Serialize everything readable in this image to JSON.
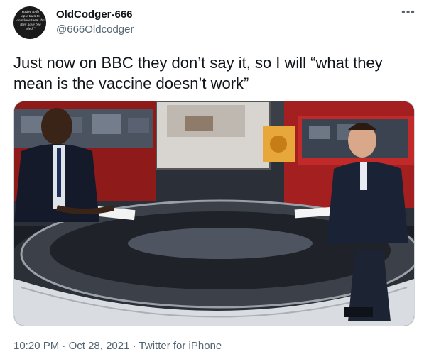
{
  "author": {
    "display_name": "OldCodger-666",
    "handle": "@666Oldcodger",
    "avatar_lines": [
      "easier to fo",
      "ople than to",
      "convince them tha",
      "they have bee",
      "oled.\""
    ]
  },
  "more_icon": "more-horizontal-icon",
  "tweet": {
    "text": "Just now on BBC they don’t say it, so I will “what they mean is the vaccine doesn’t work”"
  },
  "media": {
    "alt": "BBC news studio: two presenters at a round desk"
  },
  "meta": {
    "time": "10:20 PM",
    "separator1": " · ",
    "date": "Oct 28, 2021",
    "separator2": " · ",
    "source": "Twitter for iPhone"
  },
  "colors": {
    "text": "#0f1419",
    "secondary": "#536471",
    "border": "#cfd9de"
  }
}
